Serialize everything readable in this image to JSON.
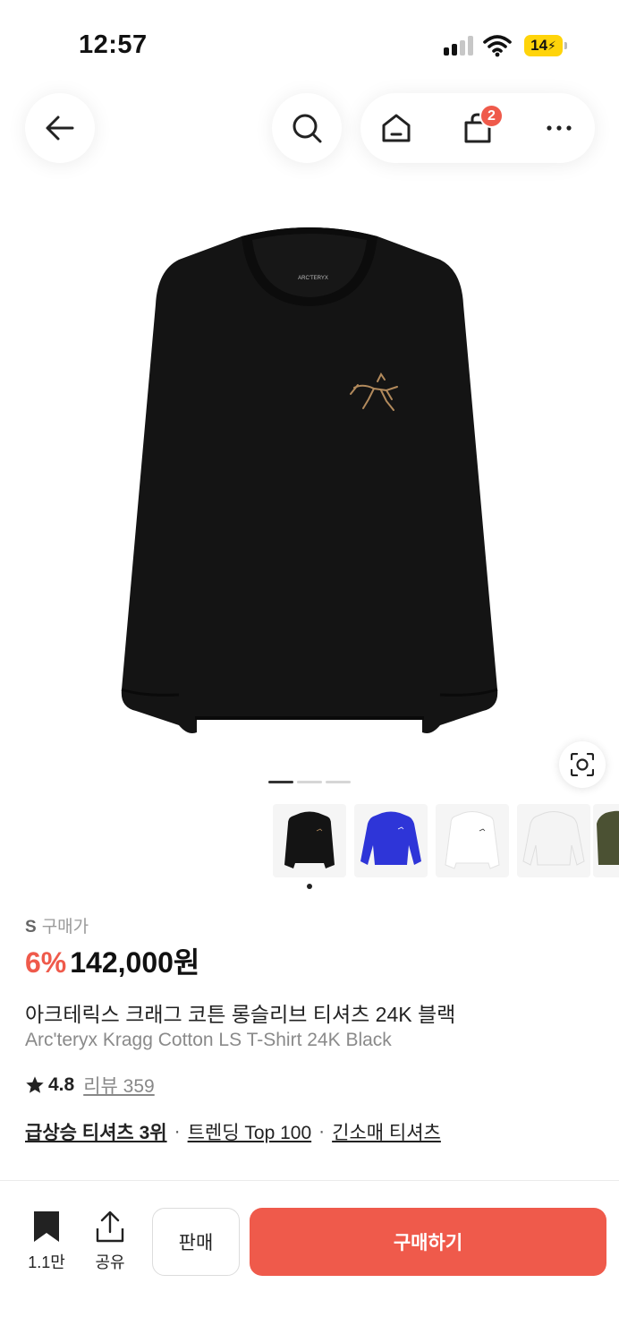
{
  "status_bar": {
    "time": "12:57",
    "battery": "14"
  },
  "nav": {
    "icons": [
      "back-arrow-icon",
      "search-icon",
      "home-icon",
      "shopping-bag-icon",
      "more-icon"
    ],
    "cart_count": "2"
  },
  "gallery": {
    "pager_count": 3,
    "active_index": 0,
    "thumbnails": [
      "black",
      "blue",
      "white",
      "white",
      "olive"
    ],
    "logo_text": "ARC'TERYX"
  },
  "product": {
    "size": "S",
    "price_label": "구매가",
    "discount": "6%",
    "price": "142,000원",
    "title_ko": "아크테릭스 크래그 코튼 롱슬리브 티셔츠 24K 블랙",
    "title_en": "Arc'teryx Kragg Cotton LS T-Shirt 24K Black",
    "rating": "4.8",
    "reviews": "리뷰 359",
    "tags": [
      "급상승 티셔츠 3위",
      "트렌딩 Top 100",
      "긴소매 티셔츠"
    ],
    "tag_separator": "·"
  },
  "bottom_bar": {
    "bookmark_count": "1.1만",
    "share_label": "공유",
    "sell_label": "판매",
    "buy_label": "구매하기"
  },
  "colors": {
    "accent": "#ef5a4b",
    "battery": "#ffd40a",
    "logo_tan": "#b28a5c"
  }
}
